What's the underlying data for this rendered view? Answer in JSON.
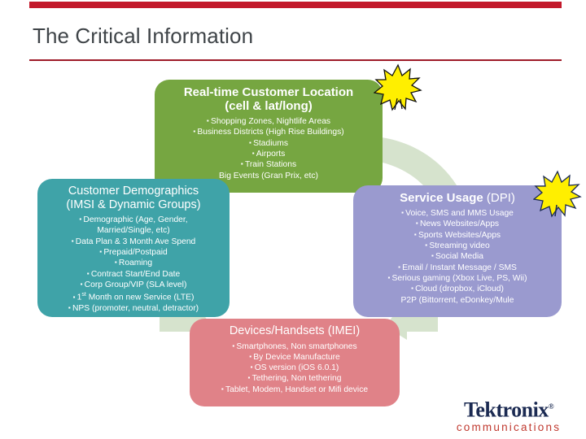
{
  "slide": {
    "title": "The Critical Information",
    "accent_red": "#c3192b",
    "rule_red": "#9e1b28"
  },
  "boxes": {
    "location": {
      "heading_line1": "Real-time Customer Location",
      "heading_line2": "(cell & lat/long)",
      "color": "#76a641",
      "items": [
        "Shopping Zones, Nightlife Areas",
        "Business Districts (High Rise Buildings)",
        "Stadiums",
        "Airports",
        "Train Stations",
        "Big Events (Gran Prix, etc)"
      ]
    },
    "demographics": {
      "heading_line1": "Customer Demographics",
      "heading_line2": "(IMSI & Dynamic Groups)",
      "color": "#3fa3a8",
      "items": [
        "Demographic (Age, Gender,",
        "Married/Single, etc)",
        "Data Plan & 3 Month Ave Spend",
        "Prepaid/Postpaid",
        "Roaming",
        "Contract Start/End Date",
        "Corp Group/VIP (SLA level)",
        "Month on new Service (LTE)",
        "NPS (promoter, neutral, detractor)"
      ],
      "ordinal_prefix": "1",
      "ordinal_suffix": "st"
    },
    "service_usage": {
      "heading_strong": "Service Usage",
      "heading_rest": " (DPI)",
      "color": "#9a9acf",
      "items": [
        "Voice, SMS and MMS  Usage",
        "News Websites/Apps",
        "Sports Websites/Apps",
        "Streaming video",
        "Social Media",
        "Email / Instant Message / SMS",
        "Serious gaming (Xbox Live, PS, Wii)",
        "Cloud (dropbox, iCloud)",
        "P2P (Bittorrent, eDonkey/Mule"
      ]
    },
    "devices": {
      "heading": "Devices/Handsets (IMEI)",
      "color": "#e08288",
      "items": [
        "Smartphones, Non smartphones",
        "By Device Manufacture",
        "OS version (iOS 6.0.1)",
        "Tethering, Non tethering",
        "Tablet, Modem, Handset or Mifi device"
      ]
    }
  },
  "logo": {
    "brand": "Tektronix",
    "registered": "®",
    "tagline": "communications",
    "brand_color": "#1b2a52",
    "tagline_color": "#c0392f"
  },
  "decorations": {
    "starburst_color": "#ffef00",
    "cycle_arrow_color": "#d6e3cd"
  }
}
